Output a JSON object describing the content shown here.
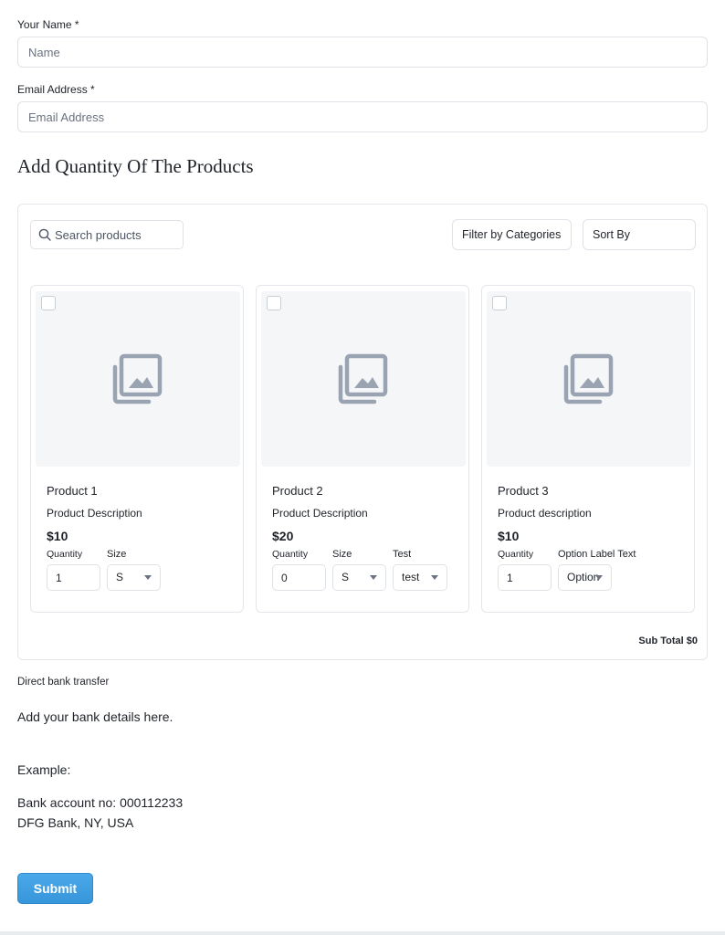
{
  "form": {
    "name_label": "Your Name *",
    "name_placeholder": "Name",
    "name_value": "",
    "email_label": "Email Address *",
    "email_placeholder": "Email Address",
    "email_value": ""
  },
  "products_section": {
    "title": "Add Quantity Of The Products",
    "search_placeholder": "Search products",
    "filter_label": "Filter by Categories",
    "sort_label": "Sort By",
    "subtotal": "Sub Total $0",
    "products": [
      {
        "name": "Product 1",
        "description": "Product Description",
        "price": "$10",
        "quantity_label": "Quantity",
        "quantity": "1",
        "options": [
          {
            "label": "Size",
            "value": "S"
          }
        ],
        "image_icon": "image-gallery-icon",
        "checked": false
      },
      {
        "name": "Product 2",
        "description": "Product Description",
        "price": "$20",
        "quantity_label": "Quantity",
        "quantity": "0",
        "options": [
          {
            "label": "Size",
            "value": "S"
          },
          {
            "label": "Test",
            "value": "test"
          }
        ],
        "image_icon": "image-gallery-icon",
        "checked": false
      },
      {
        "name": "Product 3",
        "description": "Product description",
        "price": "$10",
        "quantity_label": "Quantity",
        "quantity": "1",
        "options": [
          {
            "label": "Option Label Text",
            "value": "Option"
          }
        ],
        "image_icon": "image-gallery-icon",
        "checked": false
      }
    ]
  },
  "payment": {
    "title": "Direct bank transfer",
    "lines": [
      "Add your bank details here.",
      "Example:",
      "Bank account no: 000112233",
      "DFG Bank, NY, USA"
    ]
  },
  "submit_label": "Submit",
  "colors": {
    "accent": "#3796da",
    "border": "#dfe2e6",
    "image_placeholder_bg": "#f4f6f8",
    "image_icon": "#9aa3b2"
  },
  "icons": [
    "search-icon",
    "image-gallery-icon",
    "chevron-down-icon"
  ]
}
